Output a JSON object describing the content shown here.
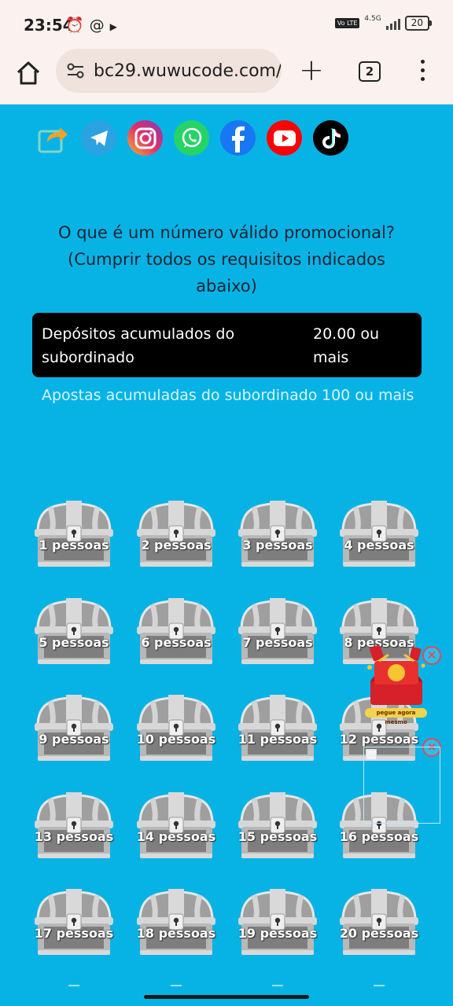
{
  "status_bar": {
    "time": "23:54",
    "icons": [
      "alarm-icon",
      "at-sign-icon",
      "play-icon"
    ],
    "volte": "Vo LTE",
    "network": "4.5G",
    "battery": "20"
  },
  "browser": {
    "url": "bc29.wuwucode.com/",
    "tab_count": "2",
    "icons": [
      "home-icon",
      "site-settings-icon",
      "plus-icon",
      "tabs-icon",
      "more-vert-icon"
    ]
  },
  "social_links": [
    {
      "name": "share",
      "icon": "share-icon",
      "color": "#5bc8c0"
    },
    {
      "name": "telegram",
      "icon": "telegram-icon",
      "color": "#2aa3e0"
    },
    {
      "name": "instagram",
      "icon": "instagram-icon",
      "color": "#e1306c"
    },
    {
      "name": "whatsapp",
      "icon": "whatsapp-icon",
      "color": "#25d366"
    },
    {
      "name": "facebook",
      "icon": "facebook-icon",
      "color": "#1877f2"
    },
    {
      "name": "youtube",
      "icon": "youtube-icon",
      "color": "#ff0000"
    },
    {
      "name": "tiktok",
      "icon": "tiktok-icon",
      "color": "#000000"
    }
  ],
  "promo": {
    "question_line1": "O que é um número válido promocional?",
    "question_line2": "(Cumprir todos os requisitos indicados",
    "question_line3": "abaixo)",
    "deposit_label_1": "Depósitos acumulados do",
    "deposit_label_2": "subordinado",
    "deposit_value_1": "20.00 ou",
    "deposit_value_2": "mais",
    "bet_label": "Apostas acumuladas do subordinado",
    "bet_value": "100 ou mais"
  },
  "chests": [
    "1 pessoas",
    "2 pessoas",
    "3 pessoas",
    "4 pessoas",
    "5 pessoas",
    "6 pessoas",
    "7 pessoas",
    "8 pessoas",
    "9 pessoas",
    "10 pessoas",
    "11 pessoas",
    "12 pessoas",
    "13 pessoas",
    "14 pessoas",
    "15 pessoas",
    "16 pessoas",
    "17 pessoas",
    "18 pessoas",
    "19 pessoas",
    "20 pessoas"
  ],
  "floating": {
    "gift_banner": "pegue agora mesmo",
    "close_symbol": "×"
  },
  "colors": {
    "page_background": "#07b3e5",
    "browser_chrome": "#fbf2ef",
    "requirement_box": "#000000",
    "chest_silver": "#b5b5b5"
  }
}
